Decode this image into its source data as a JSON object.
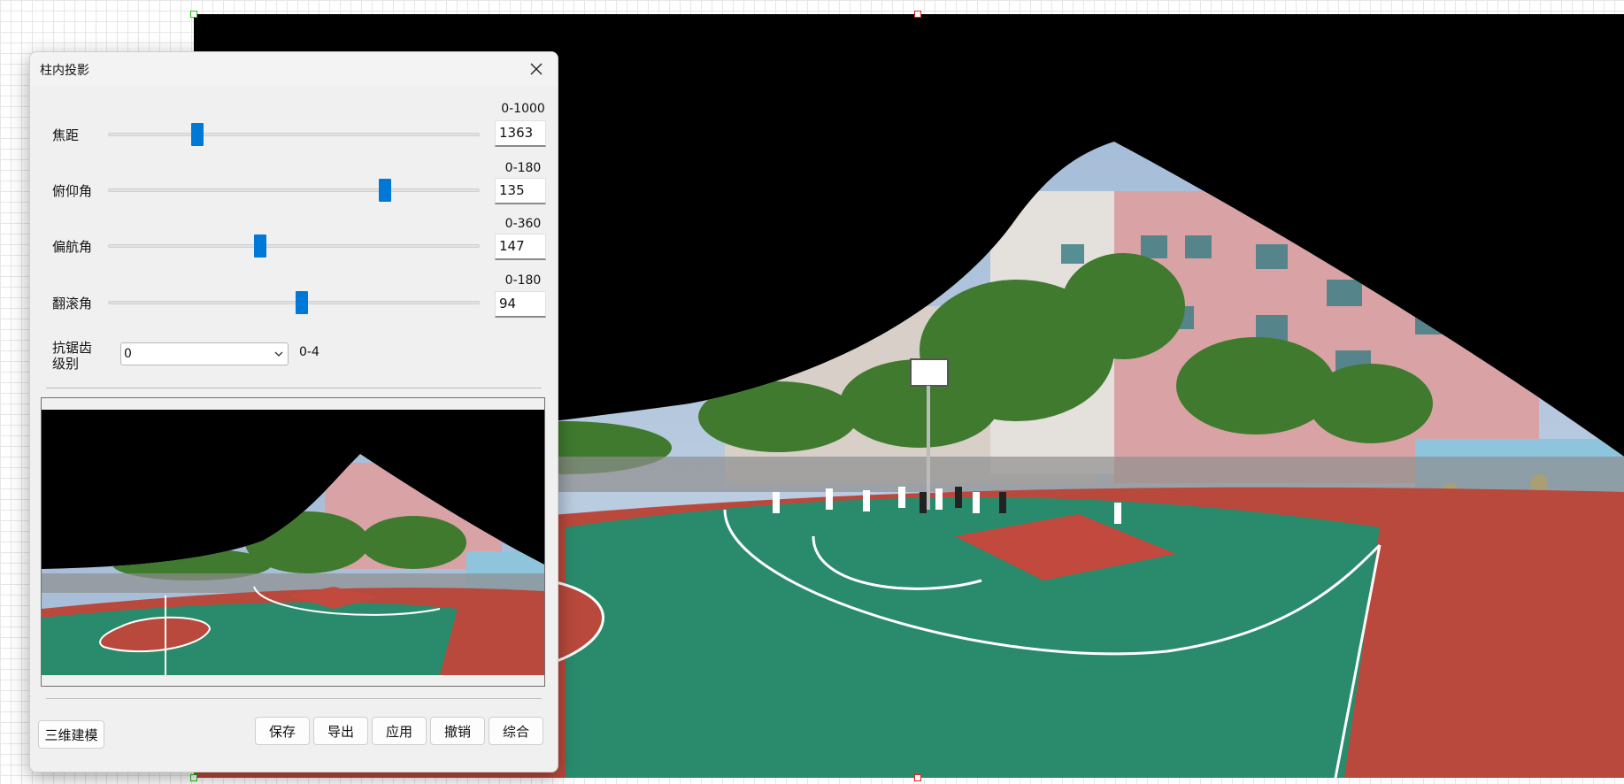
{
  "dialog": {
    "title": "柱内投影",
    "close_icon": "close-icon",
    "params": [
      {
        "label": "焦距",
        "range": "0-1000",
        "value": "1363",
        "slider_fraction": 0.24
      },
      {
        "label": "俯仰角",
        "range": "0-180",
        "value": "135",
        "slider_fraction": 0.745
      },
      {
        "label": "偏航角",
        "range": "0-360",
        "value": "147",
        "slider_fraction": 0.41
      },
      {
        "label": "翻滚角",
        "range": "0-180",
        "value": "94",
        "slider_fraction": 0.522
      }
    ],
    "antialias": {
      "label": "抗锯齿级别",
      "selected": "0",
      "range": "0-4"
    },
    "buttons": {
      "model3d": "三维建模",
      "save": "保存",
      "export": "导出",
      "apply": "应用",
      "undo": "撤销",
      "combine": "综合"
    }
  },
  "colors": {
    "accent": "#0078d7",
    "court_green": "#2a8b6c",
    "court_red": "#b9493c",
    "building_pink": "#d9a3a6",
    "tree_green": "#3f7a2e"
  }
}
